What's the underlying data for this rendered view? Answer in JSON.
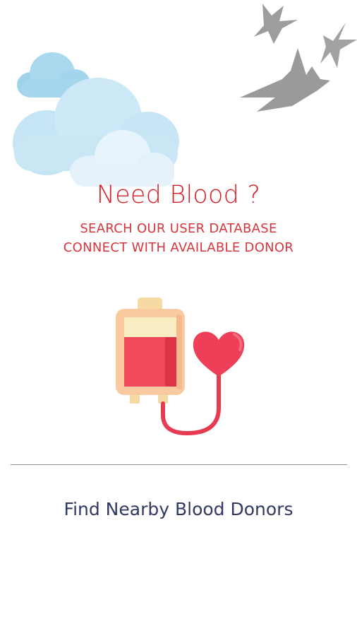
{
  "hero": {
    "title": "Need Blood ?",
    "subtitle_line_1": "SEARCH OUR USER DATABASE",
    "subtitle_line_2": "CONNECT WITH AVAILABLE DONOR"
  },
  "illustrations": {
    "clouds": "cloud-icon",
    "birds": "birds-icon",
    "transfusion": "blood-bag-heart-icon"
  },
  "actions": {
    "find_donors_label": "Find Nearby Blood Donors"
  },
  "colors": {
    "accent_red": "#d81f26",
    "link_navy": "#2f3a63",
    "divider_gray": "#8a8d93"
  }
}
